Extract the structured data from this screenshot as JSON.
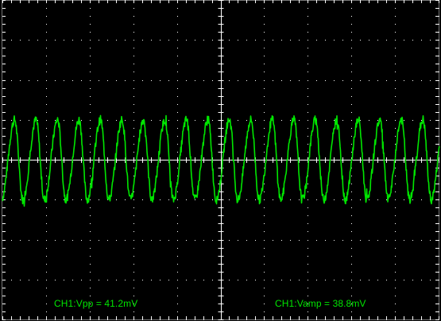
{
  "colors": {
    "background": "#000000",
    "grid": "#ffffff",
    "trace": "#00e600",
    "readout_text": "#00e600"
  },
  "graticule": {
    "divisions_x": 10,
    "divisions_y": 8,
    "minor_subdivisions": 5
  },
  "measurements": {
    "vpp": "CH1:Vpp = 41.2mV",
    "vamp": "CH1:Vamp = 38.8mV"
  },
  "chart_data": {
    "type": "line",
    "title": "",
    "xlabel": "",
    "ylabel": "",
    "series": [
      {
        "channel": "CH1",
        "waveform": "periodic sawtooth-like",
        "cycles_visible": 20.3,
        "amplitude_divisions": 1.0,
        "offset_divisions": 0.0,
        "vpp_mV": 41.2,
        "vamp_mV": 38.8
      }
    ],
    "grid": true
  }
}
